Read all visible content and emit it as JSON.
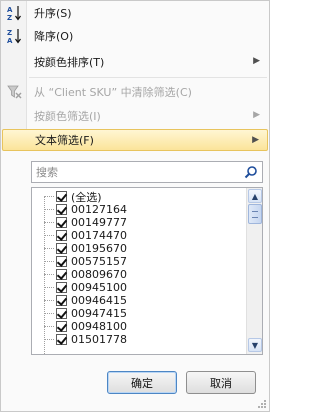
{
  "menu": {
    "items": [
      {
        "label": "升序(S)",
        "icon": "sort-az-icon",
        "disabled": false,
        "submenu": false
      },
      {
        "label": "降序(O)",
        "icon": "sort-za-icon",
        "disabled": false,
        "submenu": false
      },
      {
        "label": "按颜色排序(T)",
        "icon": "",
        "disabled": false,
        "submenu": true
      },
      {
        "label": "从 “Client SKU” 中清除筛选(C)",
        "icon": "clear-filter-icon",
        "disabled": true,
        "submenu": false
      },
      {
        "label": "按颜色筛选(I)",
        "icon": "",
        "disabled": true,
        "submenu": true
      },
      {
        "label": "文本筛选(F)",
        "icon": "",
        "disabled": false,
        "submenu": true,
        "highlighted": true
      }
    ]
  },
  "search": {
    "placeholder": "搜索",
    "value": ""
  },
  "list": {
    "items": [
      {
        "label": "(全选)",
        "checked": true
      },
      {
        "label": "00127164",
        "checked": true
      },
      {
        "label": "00149777",
        "checked": true
      },
      {
        "label": "00174470",
        "checked": true
      },
      {
        "label": "00195670",
        "checked": true
      },
      {
        "label": "00575157",
        "checked": true
      },
      {
        "label": "00809670",
        "checked": true
      },
      {
        "label": "00945100",
        "checked": true
      },
      {
        "label": "00946415",
        "checked": true
      },
      {
        "label": "00947415",
        "checked": true
      },
      {
        "label": "00948100",
        "checked": true
      },
      {
        "label": "01501778",
        "checked": true
      }
    ]
  },
  "buttons": {
    "ok": "确定",
    "cancel": "取消"
  },
  "colors": {
    "highlight": "#fbe49a",
    "icon_blue": "#1f4e9c",
    "disabled_text": "#a6a6a6"
  }
}
